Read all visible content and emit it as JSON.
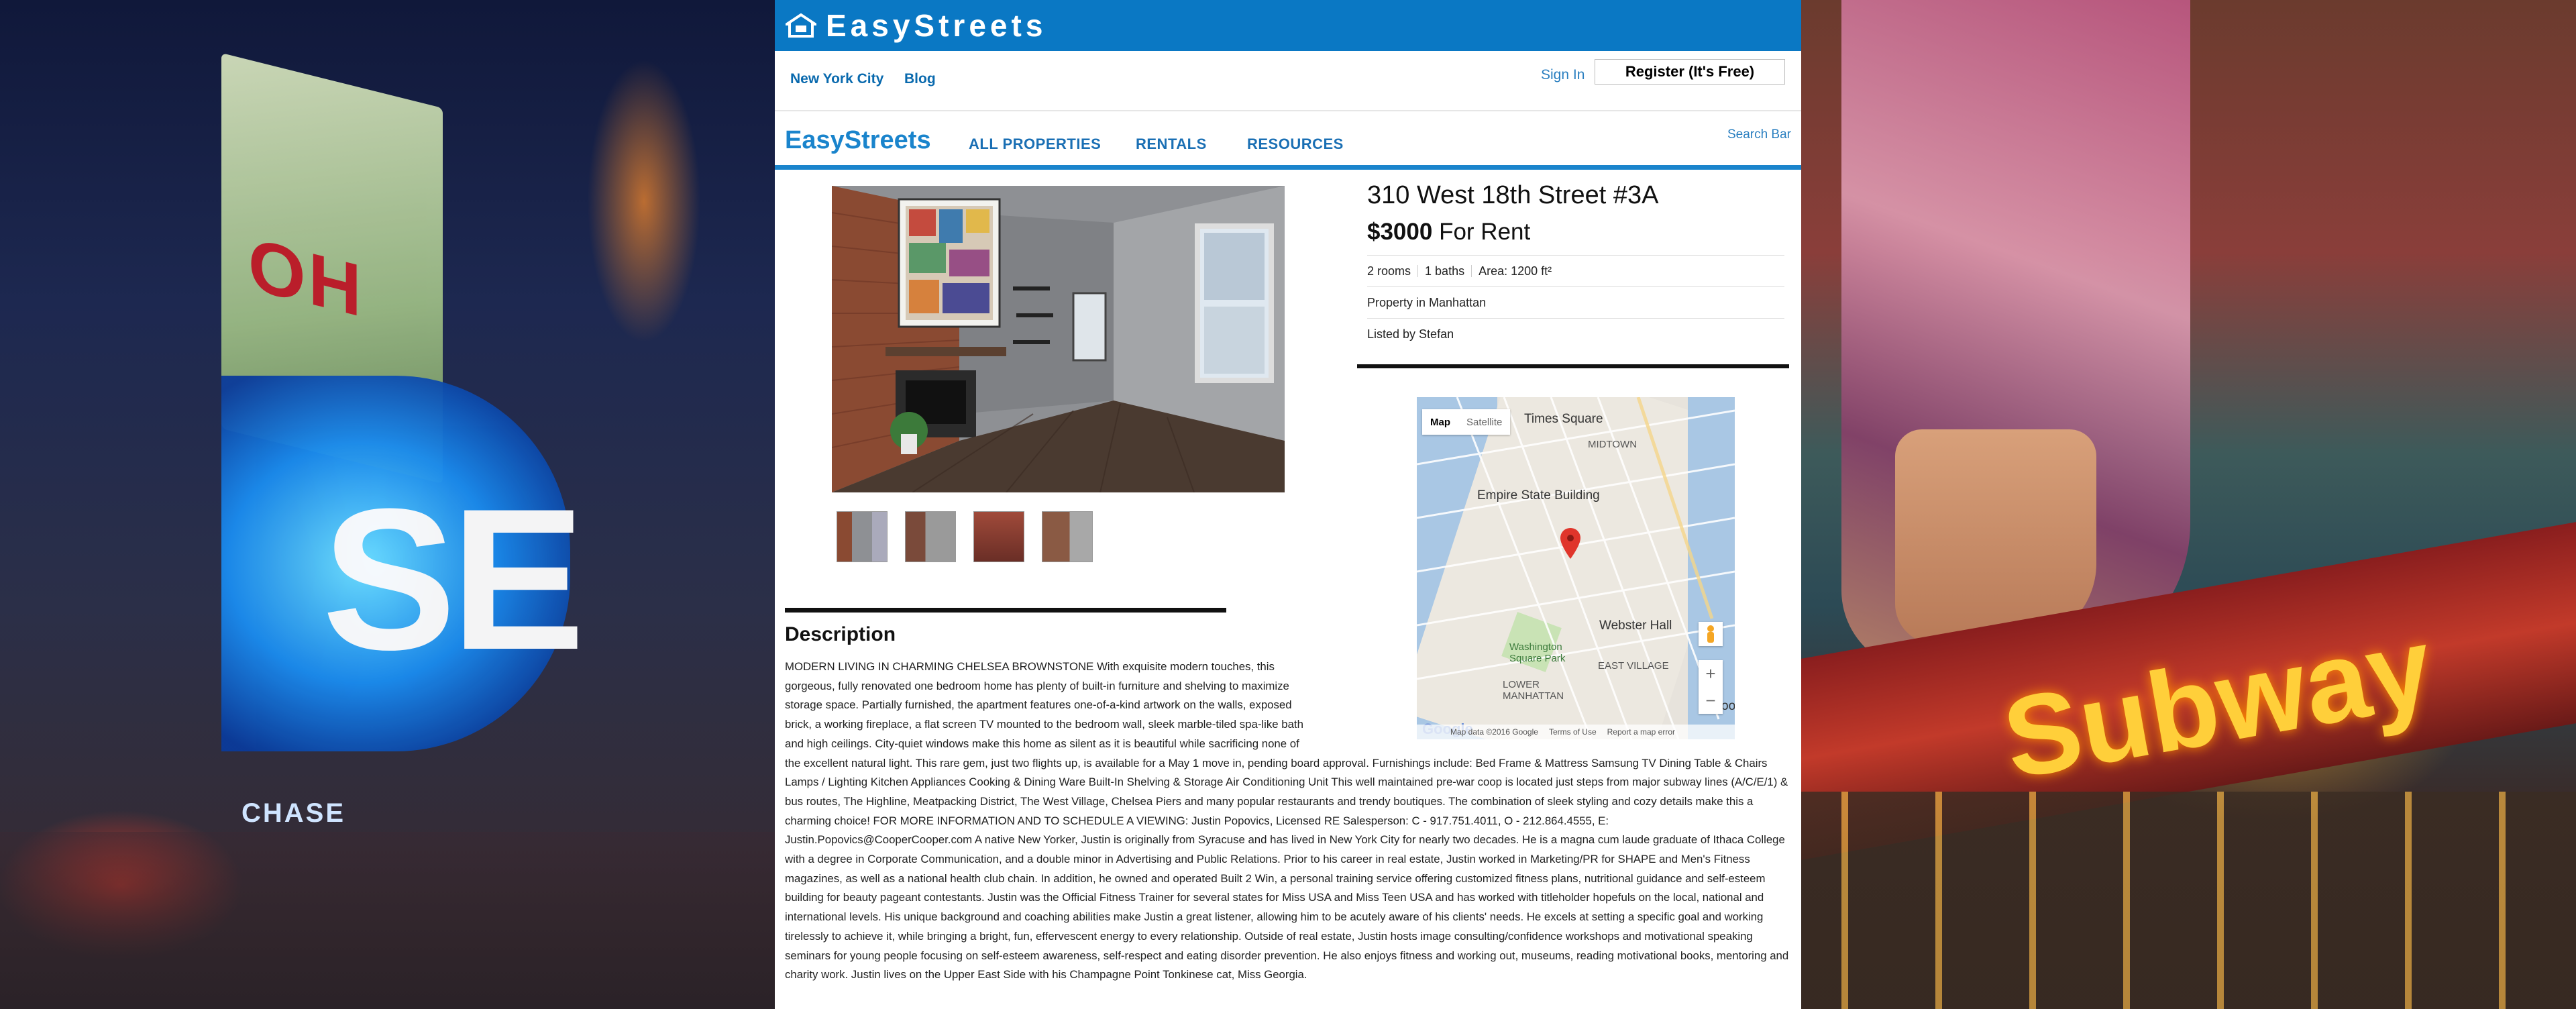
{
  "brand": {
    "name": "EasyStreets",
    "nav_brand": "EasyStreets"
  },
  "subnav": {
    "links": [
      "New York City",
      "Blog"
    ],
    "signin": "Sign In",
    "register": "Register (It's Free)"
  },
  "mainnav": {
    "items": [
      "ALL PROPERTIES",
      "RENTALS",
      "RESOURCES"
    ],
    "search": "Search Bar"
  },
  "listing": {
    "address": "310 West 18th Street #3A",
    "price": "$3000",
    "price_suffix": "For Rent",
    "rooms": "2 rooms",
    "baths": "1 baths",
    "area": "Area: 1200 ft²",
    "location": "Property in Manhattan",
    "listed_by": "Listed by Stefan"
  },
  "description": {
    "title": "Description",
    "text": "MODERN LIVING IN CHARMING CHELSEA BROWNSTONE With exquisite modern touches, this gorgeous, fully renovated one bedroom home has plenty of built-in furniture and shelving to maximize storage space. Partially furnished, the apartment features one-of-a-kind artwork on the walls, exposed brick, a working fireplace, a flat screen TV mounted to the bedroom wall, sleek marble-tiled spa-like bath and high ceilings. City-quiet windows make this home as silent as it is beautiful while sacrificing none of the excellent natural light. This rare gem, just two flights up, is available for a May 1 move in, pending board approval. Furnishings include: Bed Frame & Mattress Samsung TV Dining Table & Chairs Lamps / Lighting Kitchen Appliances Cooking & Dining Ware Built-In Shelving & Storage Air Conditioning Unit This well maintained pre-war coop is located just steps from major subway lines (A/C/E/1) & bus routes, The Highline, Meatpacking District, The West Village, Chelsea Piers and many popular restaurants and trendy boutiques. The combination of sleek styling and cozy details make this a charming choice! FOR MORE INFORMATION AND TO SCHEDULE A VIEWING: Justin Popovics, Licensed RE Salesperson: C - 917.751.4011, O - 212.864.4555, E: Justin.Popovics@CooperCooper.com A native New Yorker, Justin is originally from Syracuse and has lived in New York City for nearly two decades. He is a magna cum laude graduate of Ithaca College with a degree in Corporate Communication, and a double minor in Advertising and Public Relations. Prior to his career in real estate, Justin worked in Marketing/PR for SHAPE and Men's Fitness magazines, as well as a national health club chain. In addition, he owned and operated Built 2 Win, a personal training service offering customized fitness plans, nutritional guidance and self-esteem building for beauty pageant contestants. Justin was the Official Fitness Trainer for several states for Miss USA and Miss Teen USA and has worked with titleholder hopefuls on the local, national and international levels. His unique background and coaching abilities make Justin a great listener, allowing him to be acutely aware of his clients' needs. He excels at setting a specific goal and working tirelessly to achieve it, while bringing a bright, fun, effervescent energy to every relationship. Outside of real estate, Justin hosts image consulting/confidence workshops and motivational speaking seminars for young people focusing on self-esteem awareness, self-respect and eating disorder prevention. He also enjoys fitness and working out, museums, reading motivational books, mentoring and charity work. Justin lives on the Upper East Side with his Champagne Point Tonkinese cat, Miss Georgia."
  },
  "map": {
    "tab_map": "Map",
    "tab_satellite": "Satellite",
    "labels": [
      "Times Square",
      "MIDTOWN",
      "Empire State Building",
      "Webster Hall",
      "Washington Square Park",
      "EAST VILLAGE",
      "LOWER MANHATTAN",
      "Broo"
    ],
    "zoom_in": "+",
    "zoom_out": "−",
    "footer": [
      "Map data ©2016 Google",
      "Terms of Use",
      "Report a map error"
    ],
    "google": "Google"
  },
  "background": {
    "left_sign": "OH",
    "left_screen": "SE",
    "left_bank": "CHASE",
    "right_sign": "Subway"
  },
  "colors": {
    "topbar": "#0a78c4",
    "accent": "#1a84cc",
    "link": "#0a6aae"
  }
}
